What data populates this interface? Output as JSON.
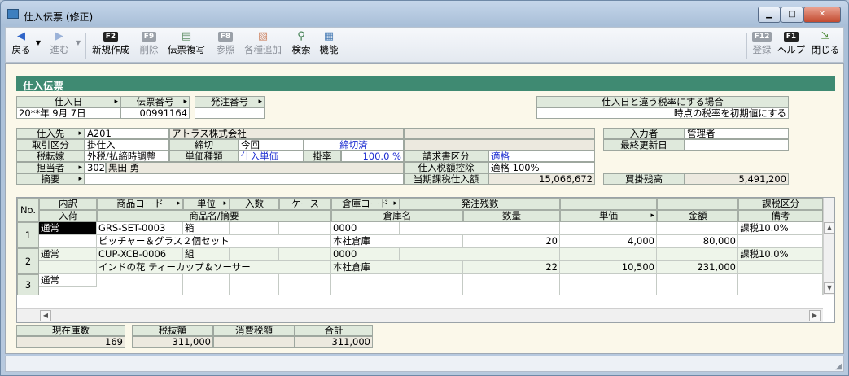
{
  "window": {
    "title": "仕入伝票 (修正)",
    "min": "▁",
    "max": "□",
    "close": "✕"
  },
  "toolbar": {
    "back": "戻る",
    "forward": "進む",
    "new_key": "F2",
    "new": "新規作成",
    "del_key": "F9",
    "del": "削除",
    "copy": "伝票複写",
    "ref_key": "F8",
    "ref": "参照",
    "append": "各種追加",
    "search": "検索",
    "func": "機能",
    "reg_key": "F12",
    "reg": "登録",
    "help_key": "F1",
    "help": "ヘルプ",
    "close": "閉じる"
  },
  "header_title": "仕入伝票",
  "form": {
    "shiire_bi_lbl": "仕入日",
    "shiire_bi": "20**年 9月 7日",
    "denpyo_no_lbl": "伝票番号",
    "denpyo_no": "00991164",
    "hacchu_no_lbl": "発注番号",
    "hacchu_no": "",
    "tax_rule_lbl": "仕入日と違う税率にする場合",
    "tax_rule": "時点の税率を初期値にする",
    "shiiresaki_lbl": "仕入先",
    "shiiresaki_code": "A201",
    "shiiresaki_name": "アトラス株式会社",
    "torihiki_lbl": "取引区分",
    "torihiki": "掛仕入",
    "shimekiri_lbl": "締切",
    "shimekiri": "今回",
    "shimekiri_status": "締切済",
    "zeitenka_lbl": "税転嫁",
    "zeitenka": "外税/払締時調整",
    "tanka_shurui_lbl": "単価種類",
    "tanka_shurui": "仕入単価",
    "kakeritsu_lbl": "掛率",
    "kakeritsu": "100.0 %",
    "seikyu_lbl": "請求書区分",
    "seikyu": "適格",
    "tanto_lbl": "担当者",
    "tanto_code": "302",
    "tanto_name": "黒田 勇",
    "koujo_lbl": "仕入税額控除",
    "koujo": "適格 100%",
    "tekiyo_lbl": "摘要",
    "tekiyo": "",
    "toki_lbl": "当期課税仕入額",
    "toki": "15,066,672",
    "nyuryoku_lbl": "入力者",
    "nyuryoku": "管理者",
    "koshin_lbl": "最終更新日",
    "koshin": "",
    "kaikake_lbl": "買掛残高",
    "kaikake": "5,491,200"
  },
  "grid": {
    "no_lbl": "No.",
    "h1": [
      "内訳",
      "商品コード",
      "単位",
      "入数",
      "ケース",
      "倉庫コード",
      "発注残数",
      "課税区分"
    ],
    "h2": [
      "入荷",
      "商品名/摘要",
      "倉庫名",
      "数量",
      "単価",
      "金額",
      "備考"
    ],
    "rows": [
      {
        "no": "1",
        "uchiwake": "通常",
        "code": "GRS-SET-0003",
        "unit": "箱",
        "name": "ピッチャー＆グラス２個セット",
        "wh_code": "0000",
        "wh_name": "本社倉庫",
        "qty": "20",
        "price": "4,000",
        "amount": "80,000",
        "tax": "課税10.0%"
      },
      {
        "no": "2",
        "uchiwake": "通常",
        "code": "CUP-XCB-0006",
        "unit": "組",
        "name": "インドの花 ティーカップ＆ソーサー",
        "wh_code": "0000",
        "wh_name": "本社倉庫",
        "qty": "22",
        "price": "10,500",
        "amount": "231,000",
        "tax": "課税10.0%"
      },
      {
        "no": "3",
        "uchiwake": "通常",
        "code": "",
        "unit": "",
        "name": "",
        "wh_code": "",
        "wh_name": "",
        "qty": "",
        "price": "",
        "amount": "",
        "tax": ""
      }
    ]
  },
  "totals": {
    "zaiko_lbl": "現在庫数",
    "zaiko": "169",
    "zeinuki_lbl": "税抜額",
    "zeinuki": "311,000",
    "shohizei_lbl": "消費税額",
    "shohizei": "",
    "gokei_lbl": "合計",
    "gokei": "311,000"
  }
}
